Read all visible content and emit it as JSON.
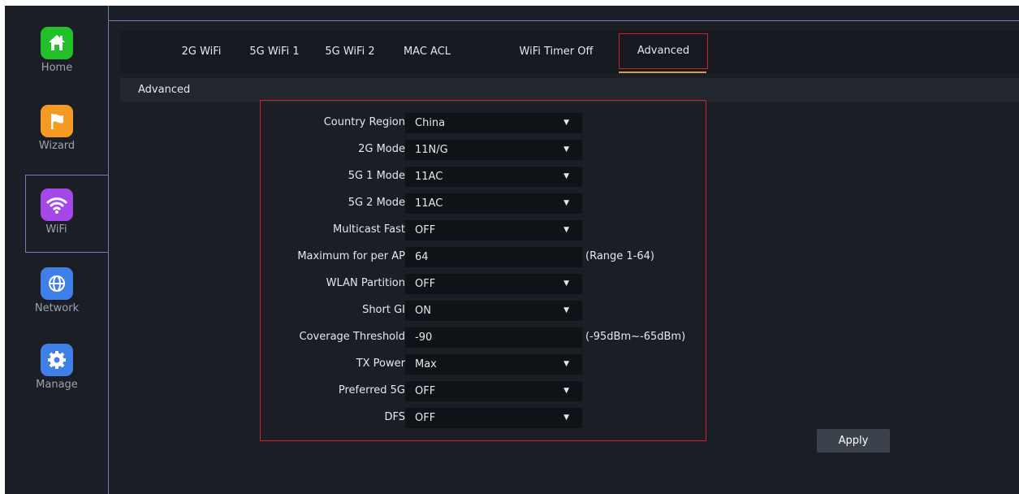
{
  "sidebar": {
    "items": [
      {
        "label": "Home",
        "icon": "home-icon",
        "color": "#22c12b"
      },
      {
        "label": "Wizard",
        "icon": "flag-icon",
        "color": "#f59a23"
      },
      {
        "label": "WiFi",
        "icon": "wifi-icon",
        "color": "#a448e8"
      },
      {
        "label": "Network",
        "icon": "globe-icon",
        "color": "#3f7fe8"
      },
      {
        "label": "Manage",
        "icon": "gear-icon",
        "color": "#3f7fe8"
      }
    ],
    "active": "WiFi"
  },
  "tabs": [
    {
      "label": "2G WiFi"
    },
    {
      "label": "5G WiFi 1"
    },
    {
      "label": "5G WiFi 2"
    },
    {
      "label": "MAC ACL"
    },
    {
      "label": "WiFi Timer Off"
    },
    {
      "label": "Advanced"
    }
  ],
  "active_tab": "Advanced",
  "section_title": "Advanced",
  "form": {
    "rows": [
      {
        "label": "Country Region",
        "value": "China",
        "type": "select"
      },
      {
        "label": "2G Mode",
        "value": "11N/G",
        "type": "select"
      },
      {
        "label": "5G 1 Mode",
        "value": "11AC",
        "type": "select"
      },
      {
        "label": "5G 2 Mode",
        "value": "11AC",
        "type": "select"
      },
      {
        "label": "Multicast Fast",
        "value": "OFF",
        "type": "select"
      },
      {
        "label": "Maximum for per AP",
        "value": "64",
        "type": "input",
        "hint": "(Range 1-64)"
      },
      {
        "label": "WLAN Partition",
        "value": "OFF",
        "type": "select"
      },
      {
        "label": "Short GI",
        "value": "ON",
        "type": "select"
      },
      {
        "label": "Coverage Threshold",
        "value": "-90",
        "type": "input",
        "hint": "(-95dBm~-65dBm)"
      },
      {
        "label": "TX Power",
        "value": "Max",
        "type": "select"
      },
      {
        "label": "Preferred 5G",
        "value": "OFF",
        "type": "select"
      },
      {
        "label": "DFS",
        "value": "OFF",
        "type": "select"
      }
    ]
  },
  "apply_label": "Apply",
  "colors": {
    "accent_border": "#d4202a",
    "tab_underline": "#caa15c",
    "frame_line": "#6f7fb8"
  }
}
